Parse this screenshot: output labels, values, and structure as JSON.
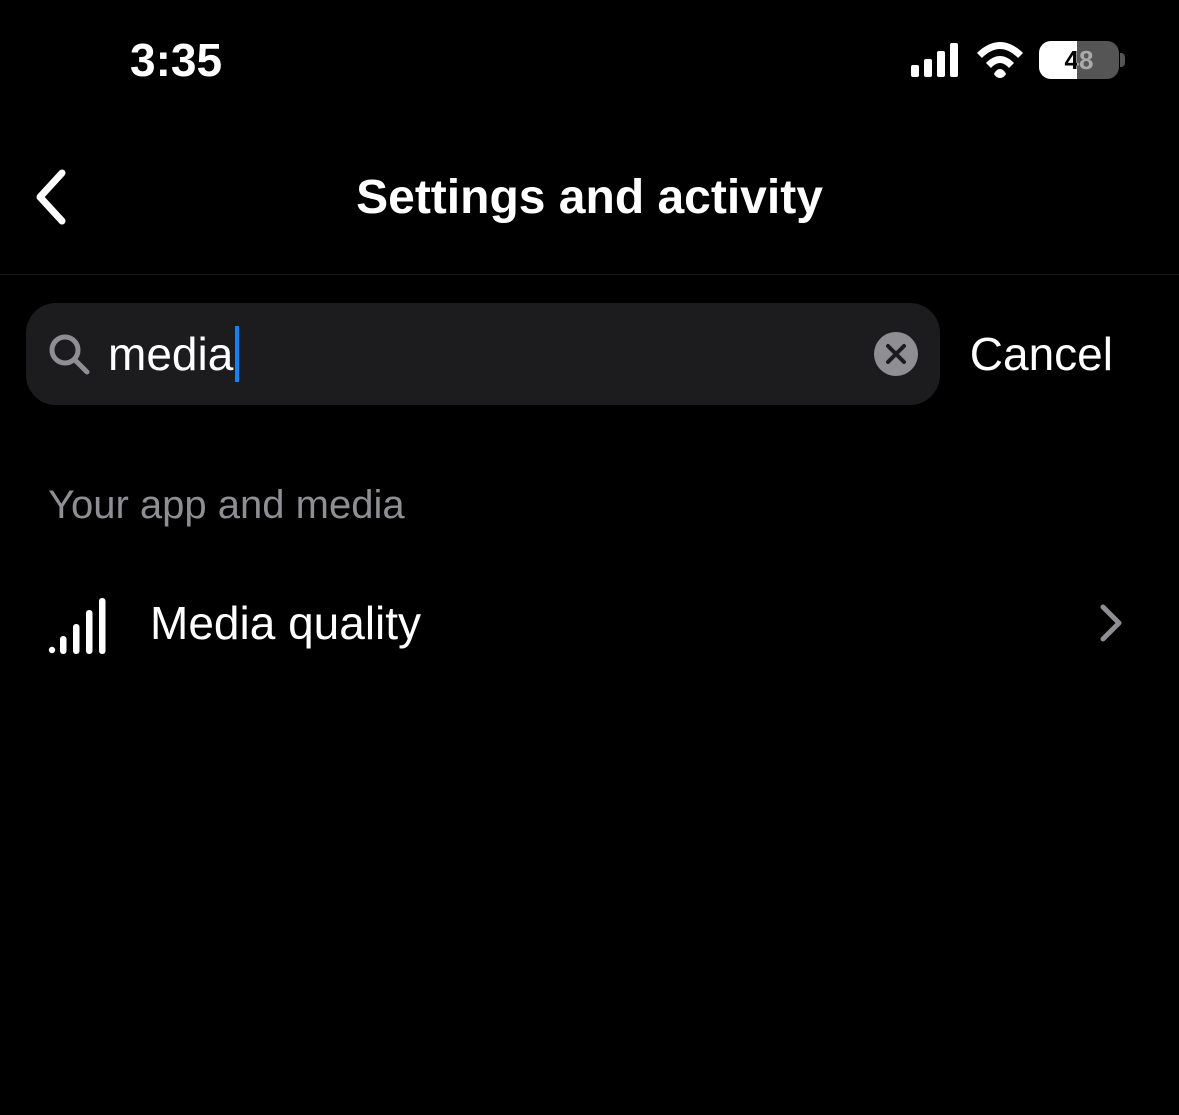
{
  "status_bar": {
    "time": "3:35",
    "battery_percent": "48"
  },
  "header": {
    "title": "Settings and activity"
  },
  "search": {
    "value": "media",
    "cancel_label": "Cancel"
  },
  "section": {
    "title": "Your app and media",
    "results": [
      {
        "label": "Media quality"
      }
    ]
  }
}
